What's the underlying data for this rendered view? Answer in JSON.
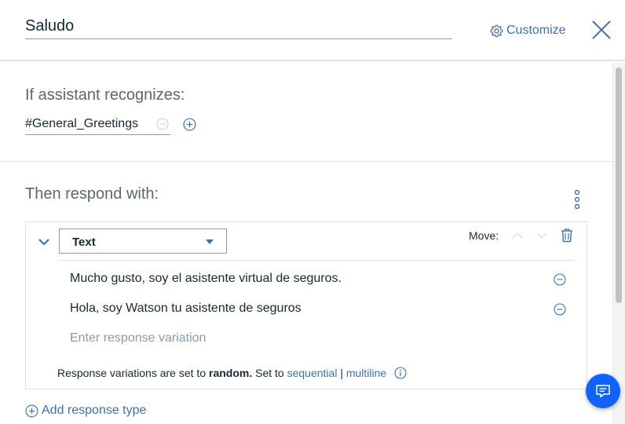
{
  "header": {
    "node_name": "Saludo",
    "customize_label": "Customize"
  },
  "conditions": {
    "title": "If assistant recognizes:",
    "intent": "#General_Greetings"
  },
  "responses": {
    "title": "Then respond with:",
    "response_type": "Text",
    "move_label": "Move:",
    "variations": [
      "Mucho gusto, soy el asistente virtual de seguros.",
      "Hola, soy Watson tu asistente de seguros"
    ],
    "variation_placeholder": "Enter response variation",
    "footer": {
      "prefix": "Response variations are set to",
      "mode": "random.",
      "set_to": "Set to",
      "sequential": "sequential",
      "separator": "|",
      "multiline": "multiline"
    },
    "add_response_type": "Add response type"
  },
  "colors": {
    "accent": "#3d70b2",
    "fab": "#0f62fe",
    "text": "#152935",
    "muted": "#5a6872"
  }
}
